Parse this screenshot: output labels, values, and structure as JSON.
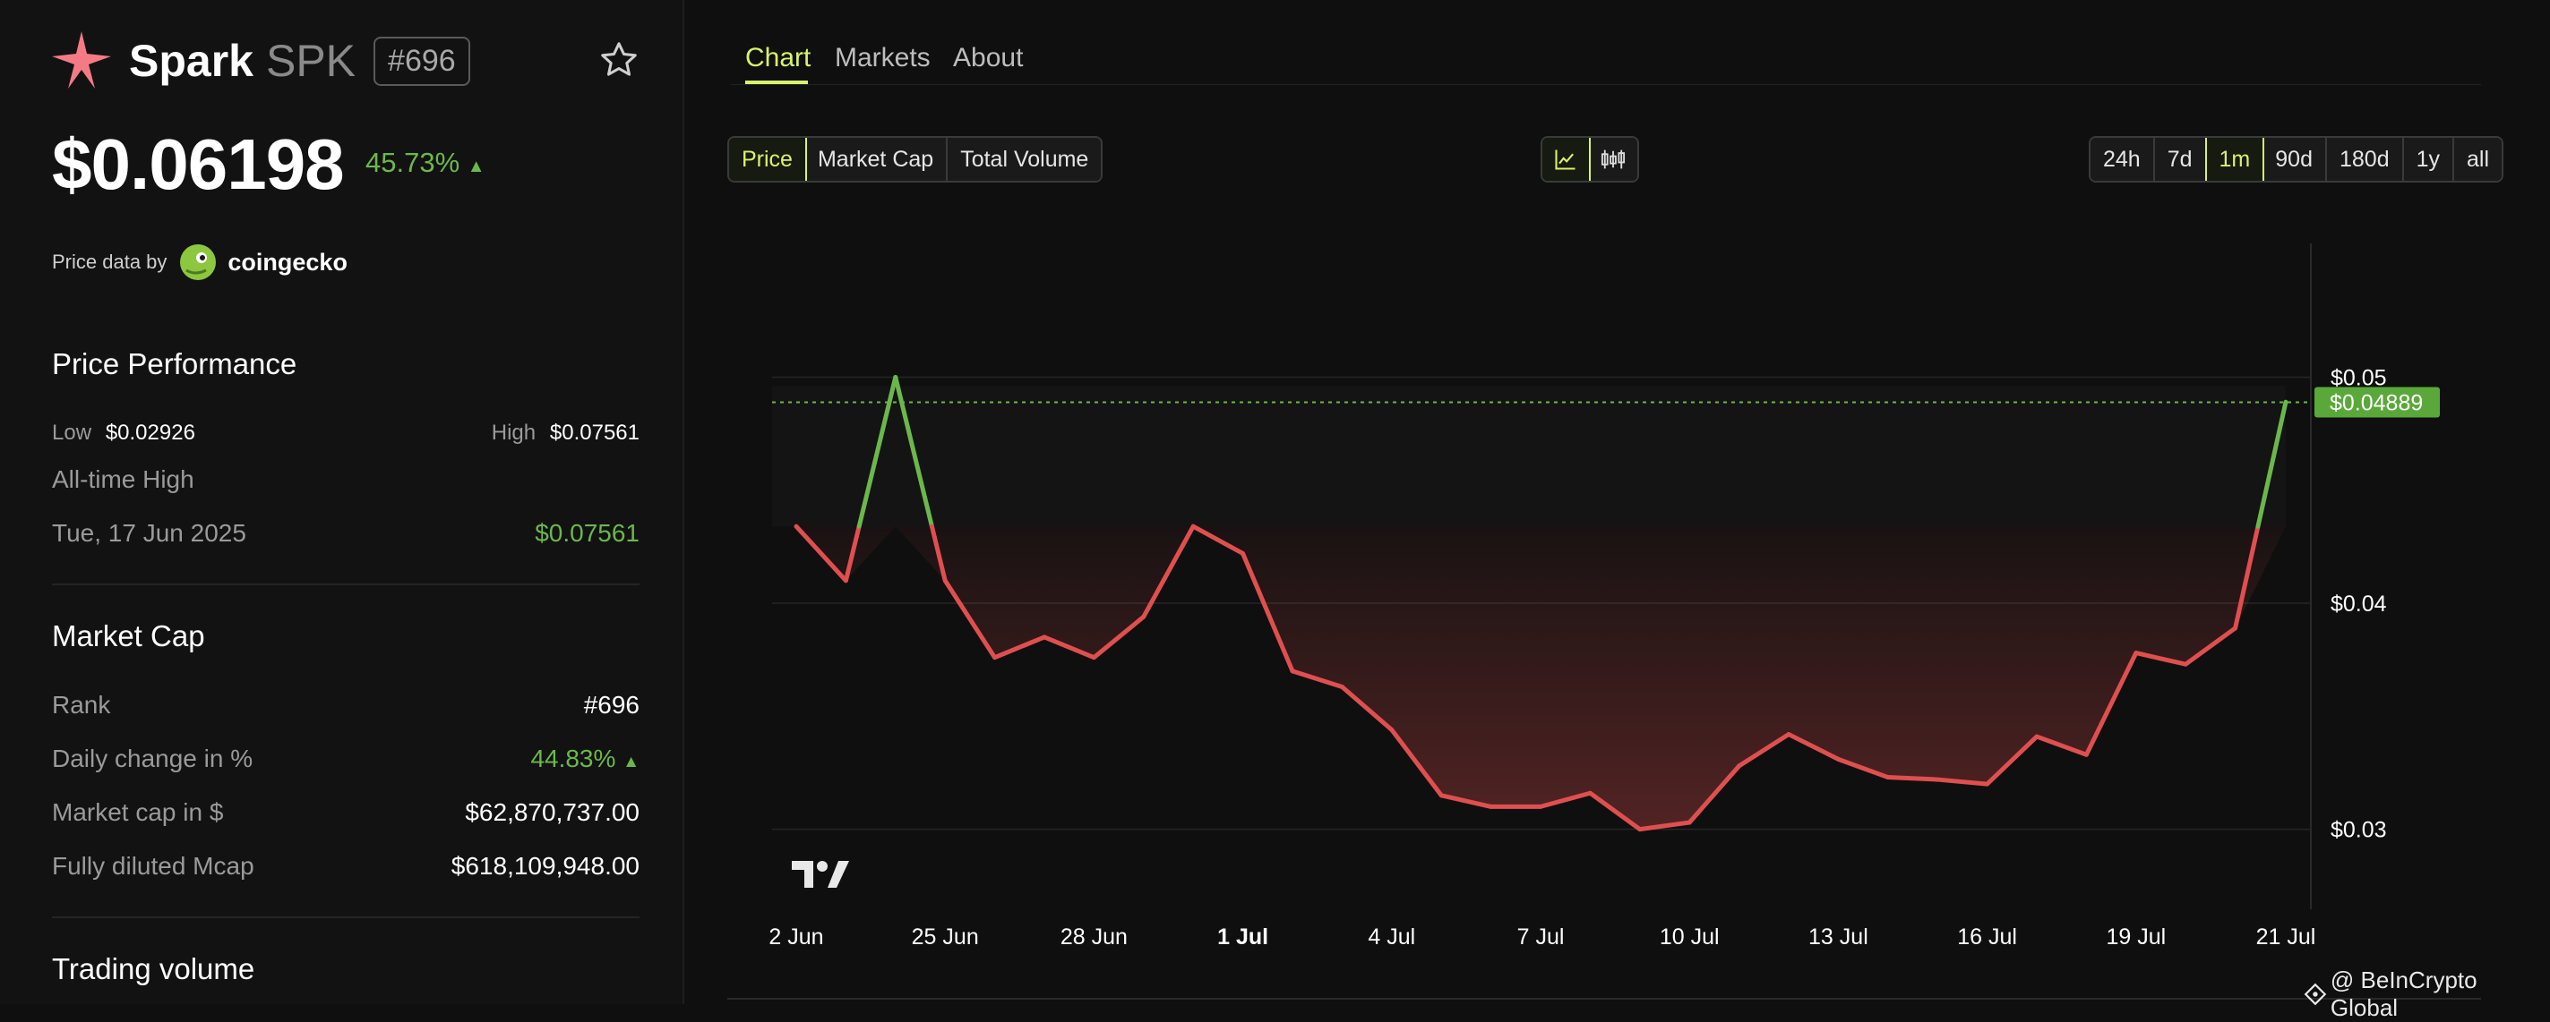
{
  "coin": {
    "name": "Spark",
    "symbol": "SPK",
    "rank_badge": "#696",
    "price": "$0.06198",
    "change_24h": "45.73%",
    "change_arrow": "▲",
    "price_data_by_label": "Price data by",
    "provider": "coingecko"
  },
  "price_performance": {
    "title": "Price Performance",
    "low_label": "Low",
    "low_value": "$0.02926",
    "high_label": "High",
    "high_value": "$0.07561",
    "ath_label": "All-time High",
    "ath_date": "Tue, 17 Jun 2025",
    "ath_value": "$0.07561"
  },
  "market_cap": {
    "title": "Market Cap",
    "rows": [
      {
        "label": "Rank",
        "value": "#696"
      },
      {
        "label": "Daily change in %",
        "value": "44.83%",
        "arrow": "▲"
      },
      {
        "label": "Market cap in $",
        "value": "$62,870,737.00"
      },
      {
        "label": "Fully diluted Mcap",
        "value": "$618,109,948.00"
      }
    ]
  },
  "trading_volume": {
    "title": "Trading volume"
  },
  "tabs": [
    {
      "label": "Chart",
      "active": true
    },
    {
      "label": "Markets",
      "active": false
    },
    {
      "label": "About",
      "active": false
    }
  ],
  "metric_buttons": [
    {
      "label": "Price",
      "active": true
    },
    {
      "label": "Market Cap",
      "active": false
    },
    {
      "label": "Total Volume",
      "active": false
    }
  ],
  "range_buttons": [
    {
      "label": "24h",
      "active": false
    },
    {
      "label": "7d",
      "active": false
    },
    {
      "label": "1m",
      "active": true
    },
    {
      "label": "90d",
      "active": false
    },
    {
      "label": "180d",
      "active": false
    },
    {
      "label": "1y",
      "active": false
    },
    {
      "label": "all",
      "active": false
    }
  ],
  "chart_data": {
    "type": "line",
    "x": [
      "22 Jun",
      "23 Jun",
      "24 Jun",
      "25 Jun",
      "26 Jun",
      "27 Jun",
      "28 Jun",
      "29 Jun",
      "30 Jun",
      "1 Jul",
      "2 Jul",
      "3 Jul",
      "4 Jul",
      "5 Jul",
      "6 Jul",
      "7 Jul",
      "8 Jul",
      "9 Jul",
      "10 Jul",
      "11 Jul",
      "12 Jul",
      "13 Jul",
      "14 Jul",
      "15 Jul",
      "16 Jul",
      "17 Jul",
      "18 Jul",
      "19 Jul",
      "20 Jul",
      "21 Jul",
      "21 Jul"
    ],
    "values": [
      0.0434,
      0.041,
      0.05,
      0.041,
      0.0376,
      0.0385,
      0.0376,
      0.0394,
      0.0434,
      0.0422,
      0.037,
      0.0363,
      0.0344,
      0.0315,
      0.031,
      0.031,
      0.0316,
      0.03,
      0.0303,
      0.0328,
      0.0342,
      0.0331,
      0.0323,
      0.0322,
      0.032,
      0.0341,
      0.0333,
      0.0378,
      0.0373,
      0.0389,
      0.0489
    ],
    "baseline": 0.0434,
    "current_value": 0.04889,
    "current_label": "$0.04889",
    "y_ticks": [
      {
        "value": 0.05,
        "label": "$0.05"
      },
      {
        "value": 0.04,
        "label": "$0.04"
      },
      {
        "value": 0.03,
        "label": "$0.03"
      }
    ],
    "x_ticks": [
      {
        "label": "22 Jun",
        "text": "2 Jun",
        "index": 0,
        "bold": false
      },
      {
        "label": "25 Jun",
        "text": "25 Jun",
        "index": 3,
        "bold": false
      },
      {
        "label": "28 Jun",
        "text": "28 Jun",
        "index": 6,
        "bold": false
      },
      {
        "label": "1 Jul",
        "text": "1 Jul",
        "index": 9,
        "bold": true
      },
      {
        "label": "4 Jul",
        "text": "4 Jul",
        "index": 12,
        "bold": false
      },
      {
        "label": "7 Jul",
        "text": "7 Jul",
        "index": 15,
        "bold": false
      },
      {
        "label": "10 Jul",
        "text": "10 Jul",
        "index": 18,
        "bold": false
      },
      {
        "label": "13 Jul",
        "text": "13 Jul",
        "index": 21,
        "bold": false
      },
      {
        "label": "16 Jul",
        "text": "16 Jul",
        "index": 24,
        "bold": false
      },
      {
        "label": "19 Jul",
        "text": "19 Jul",
        "index": 27,
        "bold": false
      },
      {
        "label": "21 Jul",
        "text": "21 Jul",
        "index": 30,
        "bold": false
      }
    ],
    "ylim": [
      0.0267,
      0.0556
    ],
    "colors": {
      "up": "#6bb84a",
      "down": "#e04f4f",
      "current_badge": "#5aa83a"
    }
  },
  "watermark": "@ BeInCrypto Global"
}
